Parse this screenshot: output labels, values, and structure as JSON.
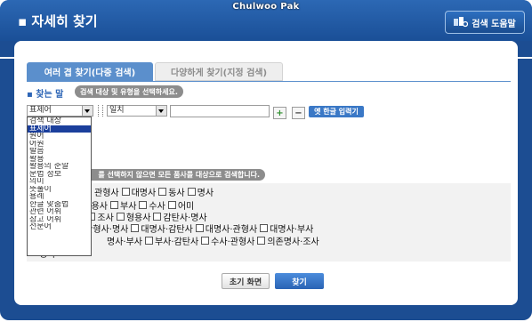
{
  "header": {
    "byline": "Chulwoo Pak",
    "title": "▪ 자세히 찾기",
    "help_label": "검색 도움말",
    "help_icon": "search-help-icon"
  },
  "tabs": [
    {
      "label": "여러 겹 찾기(다중 검색)",
      "active": true
    },
    {
      "label": "다양하게 찾기(지정 검색)",
      "active": false
    }
  ],
  "search": {
    "label": "▪ 찾는 말",
    "hint": "검색 대상 및 유형을 선택하세요.",
    "target_value": "표제어",
    "match_value": "일치",
    "query_value": "",
    "plus_label": "+",
    "minus_label": "−",
    "keyboard_label": "옛 한글 입력기"
  },
  "target_options": [
    "검색 대상",
    "표제어",
    "원어",
    "어원",
    "발음",
    "활용",
    "활용의 준말",
    "문법 정보",
    "의미",
    "뜻풀이",
    "용례",
    "한글 맞춤법",
    "관련 어휘",
    "참고 어휘",
    "전문어"
  ],
  "pos": {
    "hint": "를 선택하지 않으면 모든 품사를 대상으로 검색합니다.",
    "rows": [
      [
        "관형사",
        "대명사",
        "동사",
        "명사"
      ],
      [
        "보조형용사",
        "부사",
        "수사",
        "어미"
      ],
      [
        "접사",
        "조사",
        "형용사",
        "감탄사·명사"
      ],
      [
        "관형사·명사",
        "대명사·감탄사",
        "대명사·관형사",
        "대명사·부사"
      ],
      [
        "명사·부사",
        "부사·감탄사",
        "수사·관형사",
        "의존명사·조사"
      ],
      [
        "명사"
      ]
    ],
    "row_prefixes": [
      "",
      "",
      "",
      "사",
      "",
      ""
    ]
  },
  "actions": {
    "reset_label": "초기 화면",
    "search_label": "찾기"
  },
  "colors": {
    "frame": "#1c4d92",
    "accent": "#5b8fcc",
    "hint_bg": "#8d8d8d"
  }
}
